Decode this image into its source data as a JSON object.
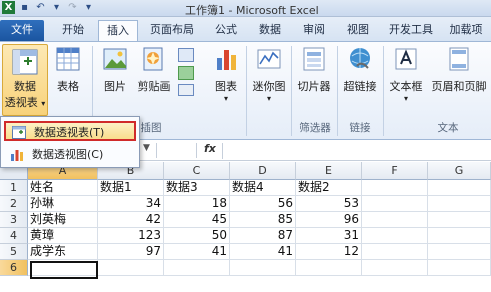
{
  "titlebar": {
    "title": "工作簿1 - Microsoft Excel"
  },
  "tabs": [
    {
      "label": "文件"
    },
    {
      "label": "开始"
    },
    {
      "label": "插入"
    },
    {
      "label": "页面布局"
    },
    {
      "label": "公式"
    },
    {
      "label": "数据"
    },
    {
      "label": "审阅"
    },
    {
      "label": "视图"
    },
    {
      "label": "开发工具"
    },
    {
      "label": "加载项"
    }
  ],
  "ribbon": {
    "pivot_label_1": "数据",
    "pivot_label_2": "透视表",
    "table": "表格",
    "picture": "图片",
    "clipart": "剪贴画",
    "chart": "图表",
    "sparkline": "迷你图",
    "slicer": "切片器",
    "hyperlink": "超链接",
    "textbox": "文本框",
    "header_footer": "页眉和页脚",
    "group_illustrations": "插图",
    "group_filter": "筛选器",
    "group_links": "链接",
    "group_text": "文本"
  },
  "menu": {
    "items": [
      {
        "label": "数据透视表(T)"
      },
      {
        "label": "数据透视图(C)"
      }
    ]
  },
  "formula_bar": {
    "fx": "fx"
  },
  "sheet": {
    "columns": [
      "A",
      "B",
      "C",
      "D",
      "E",
      "F",
      "G"
    ],
    "rows": [
      "1",
      "2",
      "3",
      "4",
      "5",
      "6"
    ],
    "cells": [
      [
        "姓名",
        "数据1",
        "数据3",
        "数据4",
        "数据2",
        "",
        ""
      ],
      [
        "孙琳",
        "34",
        "18",
        "56",
        "53",
        "",
        ""
      ],
      [
        "刘英梅",
        "42",
        "45",
        "85",
        "96",
        "",
        ""
      ],
      [
        "黄璋",
        "123",
        "50",
        "87",
        "31",
        "",
        ""
      ],
      [
        "成学东",
        "97",
        "41",
        "41",
        "12",
        "",
        ""
      ],
      [
        "",
        "",
        "",
        "",
        "",
        "",
        ""
      ]
    ]
  },
  "colors": {
    "file_tab": "#1b55a0",
    "selected_header": "#f1c15f",
    "menu_highlight_border": "#d02a2a"
  }
}
